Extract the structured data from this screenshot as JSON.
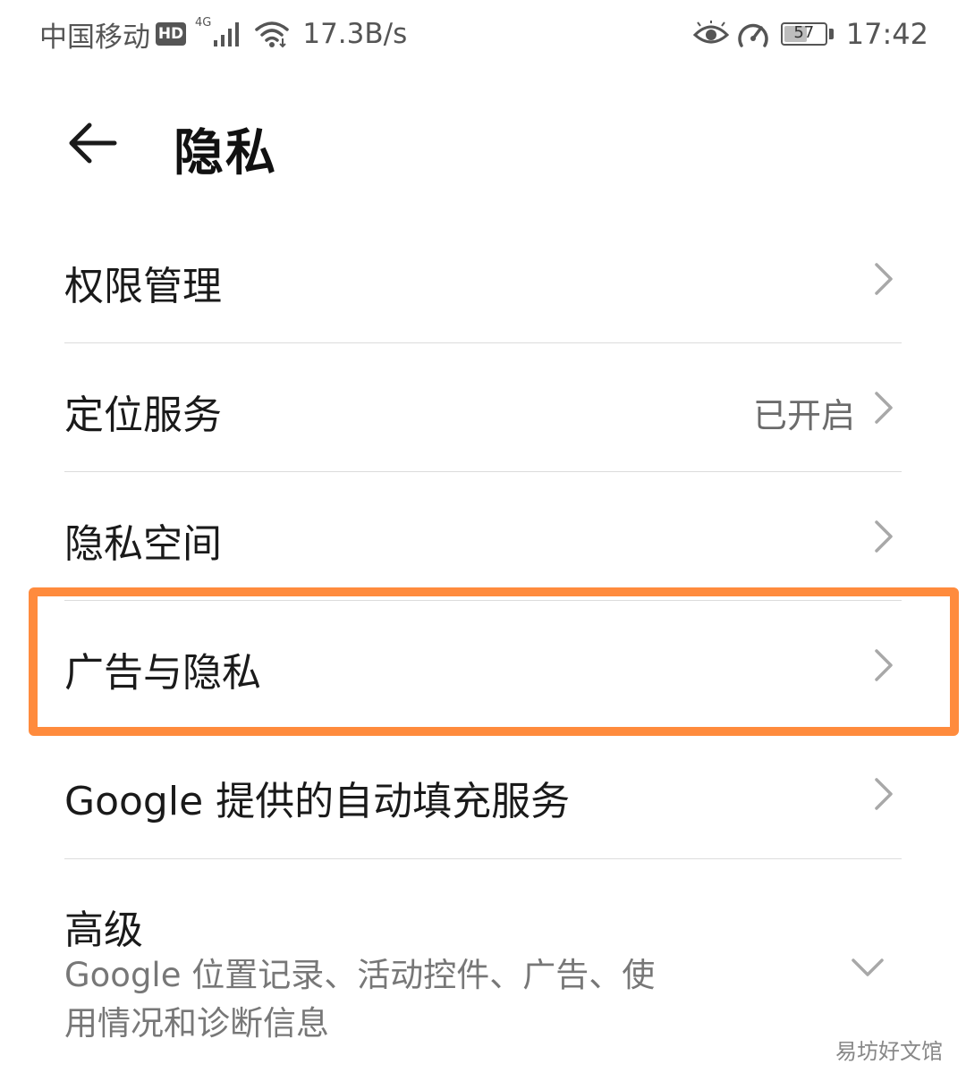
{
  "status_bar": {
    "carrier": "中国移动",
    "hd": "HD",
    "network_type": "4G",
    "net_speed": "17.3B/s",
    "battery": "57",
    "time": "17:42"
  },
  "header": {
    "title": "隐私"
  },
  "list": {
    "permission_management": "权限管理",
    "location_service": "定位服务",
    "location_value": "已开启",
    "private_space": "隐私空间",
    "ads_privacy": "广告与隐私",
    "google_autofill": "Google 提供的自动填充服务",
    "advanced": "高级",
    "advanced_subtitle_line1": "Google 位置记录、活动控件、广告、使",
    "advanced_subtitle_line2": "用情况和诊断信息"
  },
  "highlight_color": "#ff8b3d",
  "watermark": "易坊好文馆"
}
